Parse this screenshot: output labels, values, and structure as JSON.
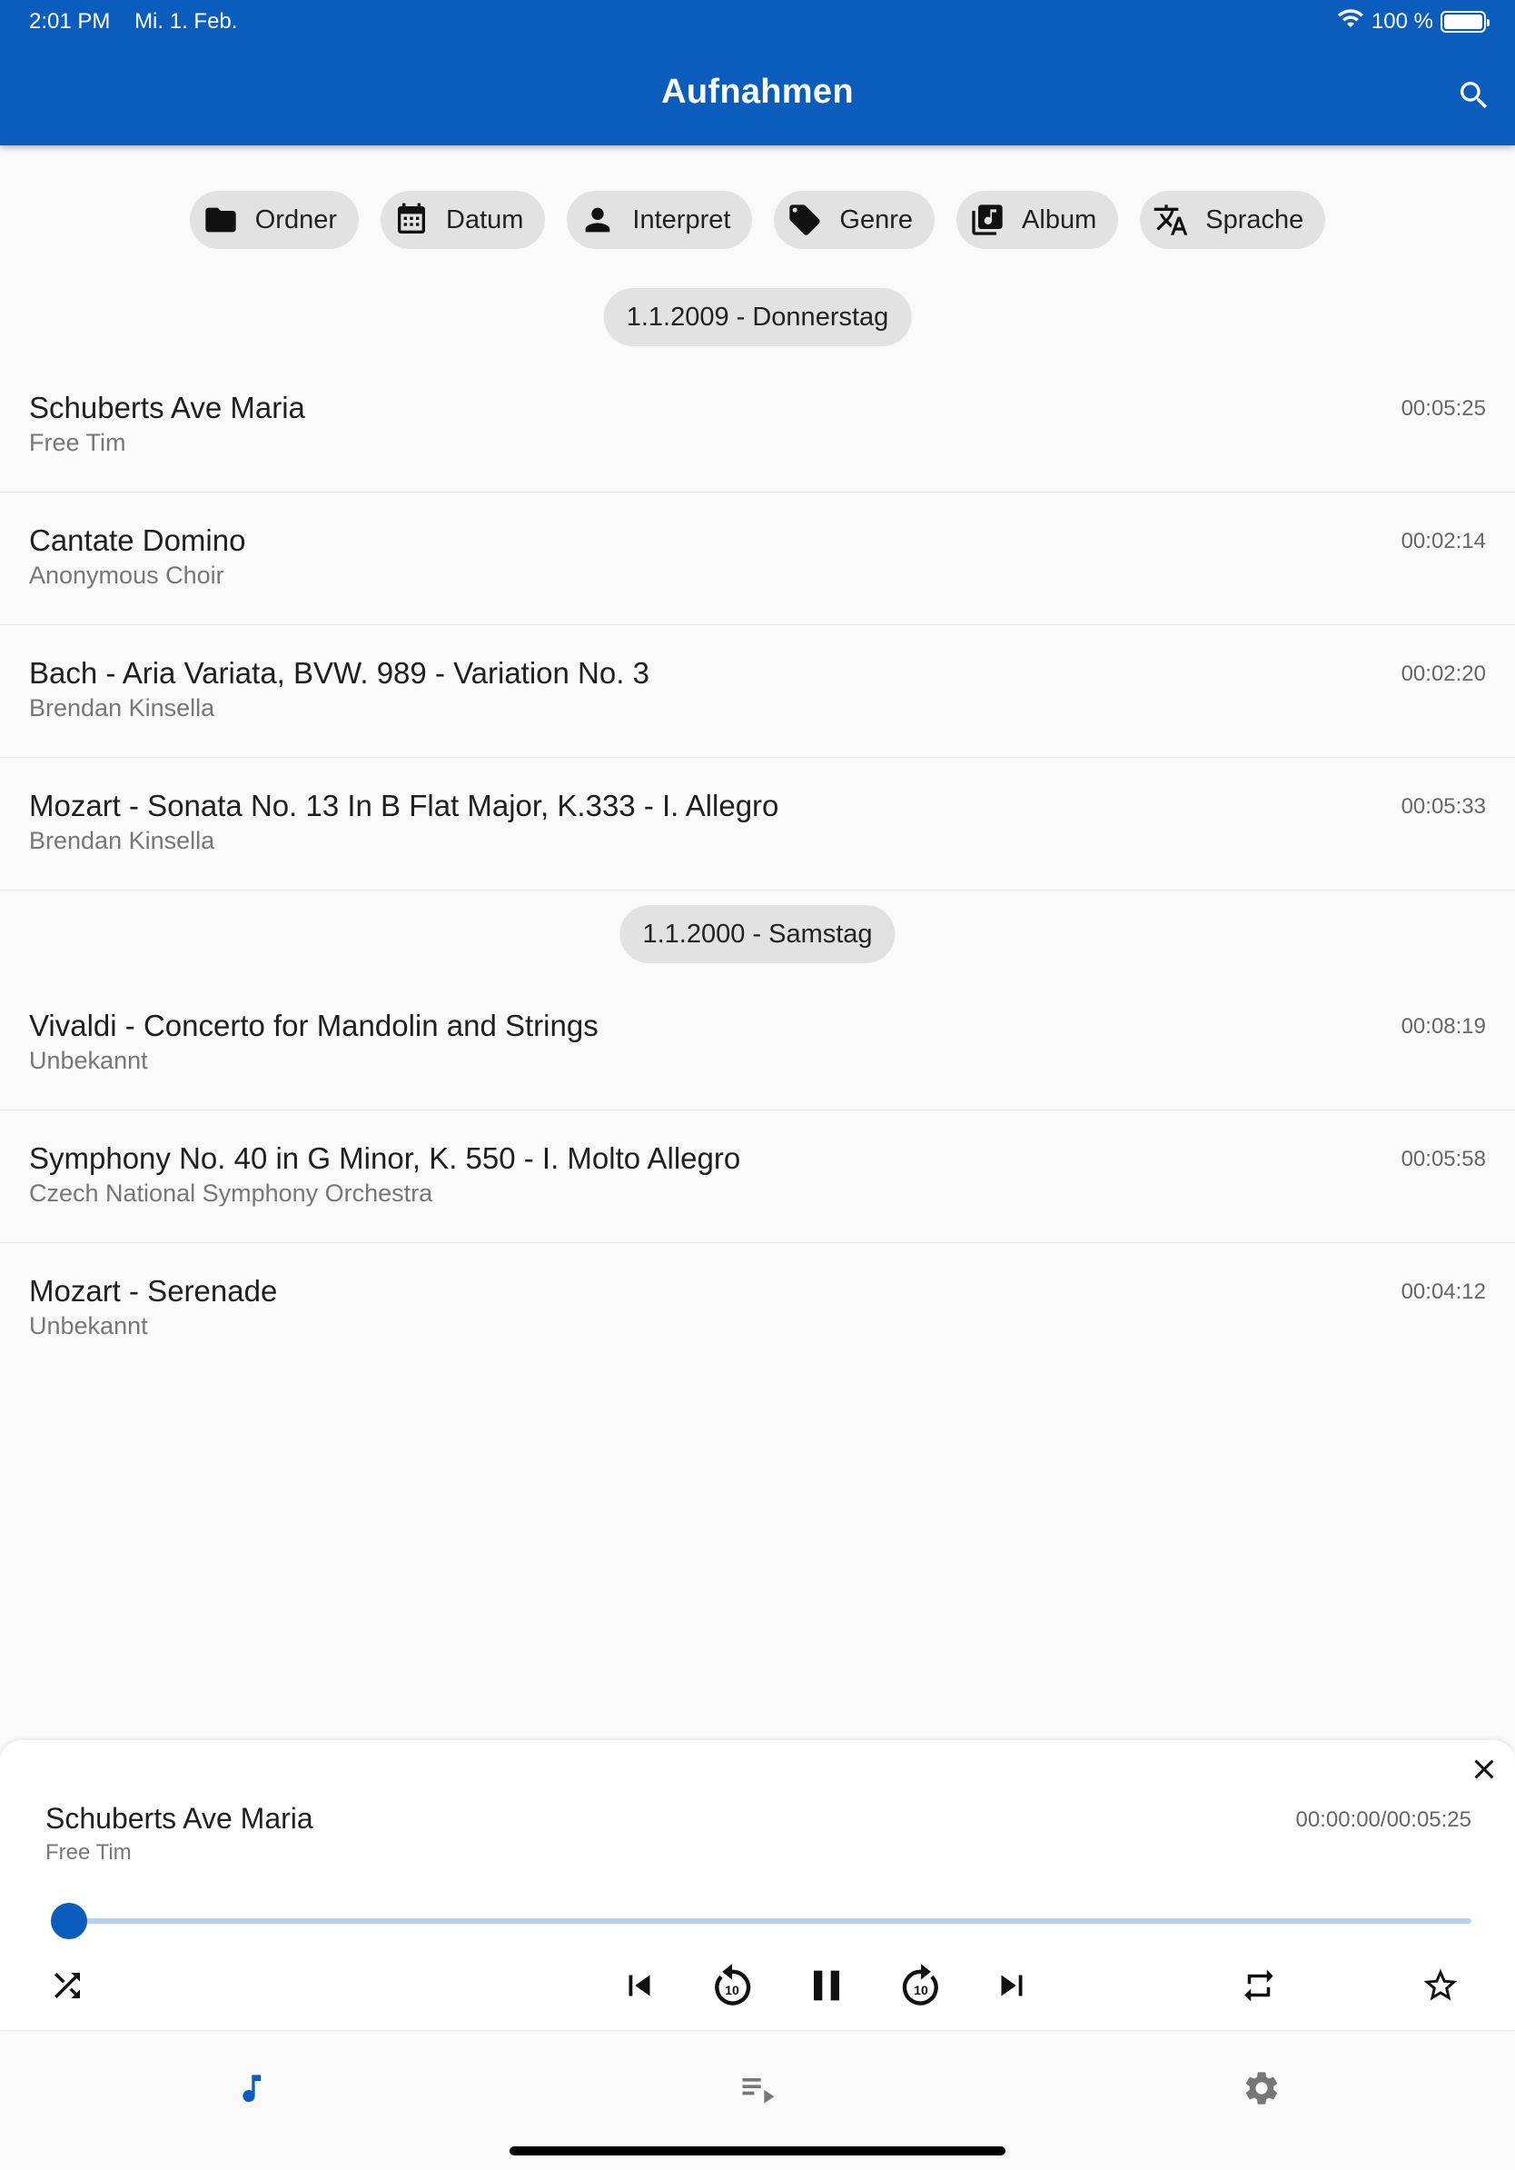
{
  "status_bar": {
    "time": "2:01 PM",
    "date": "Mi. 1. Feb.",
    "battery": "100 %"
  },
  "header": {
    "title": "Aufnahmen"
  },
  "filters": [
    {
      "label": "Ordner",
      "icon": "folder-icon"
    },
    {
      "label": "Datum",
      "icon": "calendar-icon"
    },
    {
      "label": "Interpret",
      "icon": "person-icon"
    },
    {
      "label": "Genre",
      "icon": "tag-icon"
    },
    {
      "label": "Album",
      "icon": "album-icon"
    },
    {
      "label": "Sprache",
      "icon": "translate-icon"
    }
  ],
  "groups": [
    {
      "date": "1.1.2009 - Donnerstag",
      "items": [
        {
          "title": "Schuberts Ave Maria",
          "artist": "Free Tim",
          "duration": "00:05:25"
        },
        {
          "title": "Cantate Domino",
          "artist": "Anonymous Choir",
          "duration": "00:02:14"
        },
        {
          "title": "Bach - Aria Variata, BVW. 989 - Variation No. 3",
          "artist": "Brendan Kinsella",
          "duration": "00:02:20"
        },
        {
          "title": "Mozart - Sonata No. 13 In B Flat Major, K.333 - I. Allegro",
          "artist": "Brendan Kinsella",
          "duration": "00:05:33"
        }
      ]
    },
    {
      "date": "1.1.2000 - Samstag",
      "items": [
        {
          "title": "Vivaldi - Concerto for Mandolin and Strings",
          "artist": "Unbekannt",
          "duration": "00:08:19"
        },
        {
          "title": "Symphony No. 40 in G Minor, K. 550 - I. Molto Allegro",
          "artist": "Czech National Symphony Orchestra",
          "duration": "00:05:58"
        },
        {
          "title": "Mozart - Serenade",
          "artist": "Unbekannt",
          "duration": "00:04:12"
        }
      ]
    }
  ],
  "player": {
    "title": "Schuberts Ave Maria",
    "artist": "Free Tim",
    "time": "00:00:00/00:05:25",
    "progress": 0.0,
    "controls": [
      "shuffle-icon",
      "skip-previous-icon",
      "replay-10-icon",
      "pause-icon",
      "forward-10-icon",
      "skip-next-icon",
      "repeat-icon",
      "star-outline-icon"
    ]
  },
  "bottom_nav": {
    "items": [
      "music-note-icon",
      "queue-icon",
      "settings-icon"
    ],
    "active": "music-note-icon"
  },
  "colors": {
    "primary": "#0a5cbd",
    "chip_bg": "#e2e2e2",
    "track": "#b9d0ee"
  }
}
